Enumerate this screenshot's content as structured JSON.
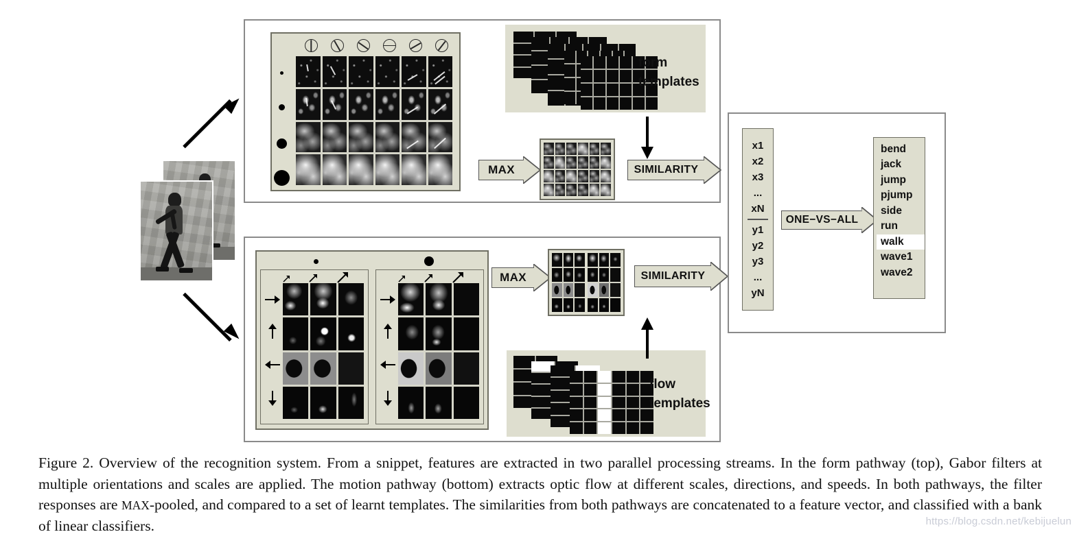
{
  "figure": {
    "caption_prefix": "Figure 2.",
    "caption_part1": " Overview of the recognition system.  From a snippet, features are extracted in two parallel processing streams.  In the form pathway (top), Gabor filters at multiple orientations and scales are applied. The motion pathway (bottom) extracts optic flow at different scales, directions, and speeds.  In both pathways, the filter responses are ",
    "caption_smallcaps": "MAX",
    "caption_part2": "-pooled, and compared to a set of learnt templates.  The similarities from both pathways are concatenated to a feature vector, and classified with a bank of linear classifiers.",
    "watermark": "https://blog.csdn.net/kebijuelun"
  },
  "form_pathway": {
    "orientations": [
      "0",
      "30",
      "45",
      "90",
      "120",
      "150"
    ],
    "scales": [
      "scale-1",
      "scale-2",
      "scale-3",
      "scale-4"
    ],
    "max_label": "MAX",
    "similarity_label": "SIMILARITY",
    "templates_label_line1": "form",
    "templates_label_line2": "templates",
    "grid_columns": 6,
    "grid_rows": 4
  },
  "motion_pathway": {
    "directions": [
      "right",
      "up",
      "left",
      "down"
    ],
    "speeds": [
      "slow",
      "medium",
      "fast"
    ],
    "scales": [
      "small",
      "large"
    ],
    "max_label": "MAX",
    "similarity_label": "SIMILARITY",
    "templates_label_line1": "flow",
    "templates_label_line2": "templates",
    "grid_columns": 3,
    "grid_rows": 4
  },
  "classifier": {
    "feature_vector_top": [
      "x1",
      "x2",
      "x3",
      "...",
      "xN"
    ],
    "feature_vector_bottom": [
      "y1",
      "y2",
      "y3",
      "...",
      "yN"
    ],
    "arrow_label": "ONE−VS−ALL",
    "classes": [
      "bend",
      "jack",
      "jump",
      "pjump",
      "side",
      "run",
      "walk",
      "wave1",
      "wave2"
    ],
    "selected_class": "walk"
  },
  "colors": {
    "beige": "#dedecf",
    "panel_border": "#8a8a8a",
    "box_border": "#6f6f63",
    "black": "#000000",
    "selected_bg": "#ffffff"
  }
}
